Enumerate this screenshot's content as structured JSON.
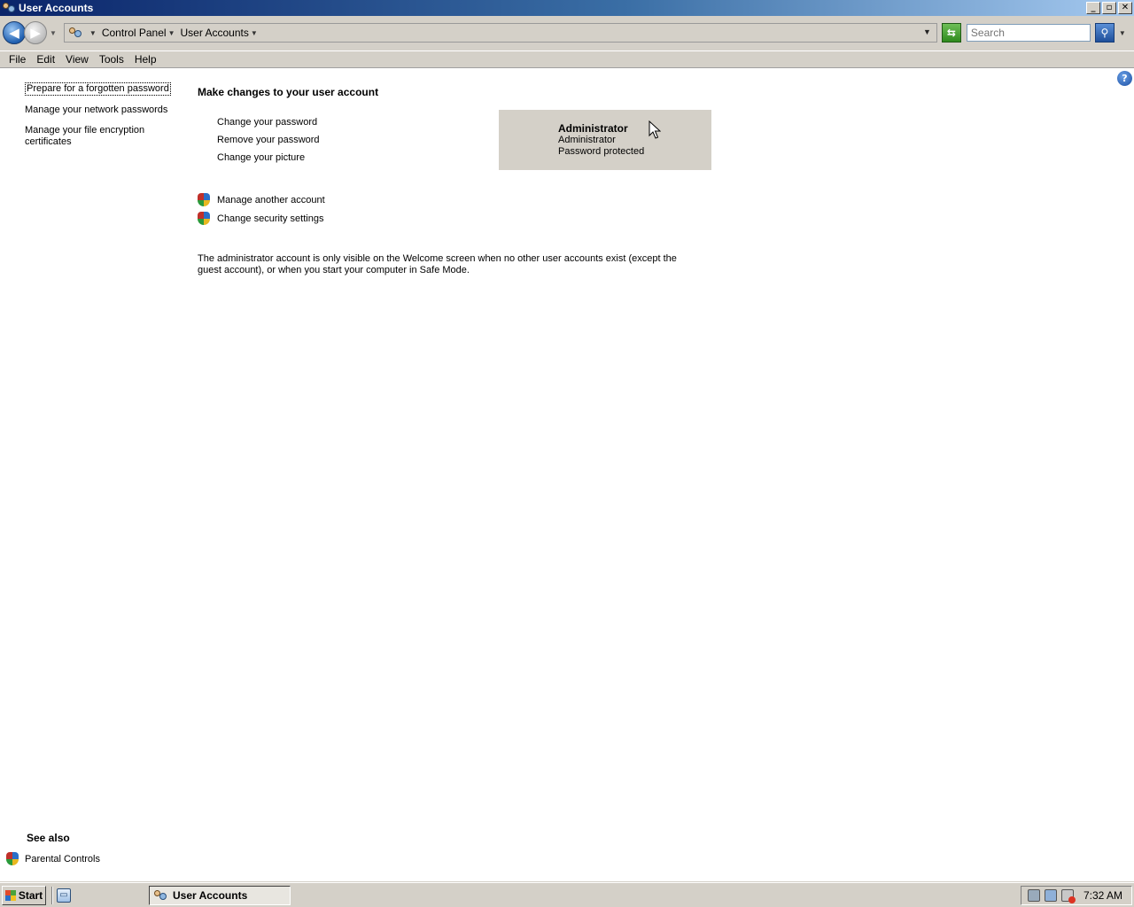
{
  "window": {
    "title": "User Accounts",
    "buttons": {
      "minimize": "_",
      "maximize": "▫",
      "close": "✕"
    }
  },
  "addressbar": {
    "breadcrumbs": [
      "Control Panel",
      "User Accounts"
    ],
    "search_placeholder": "Search"
  },
  "menu": [
    "File",
    "Edit",
    "View",
    "Tools",
    "Help"
  ],
  "help_label": "?",
  "tasks": [
    "Prepare for a forgotten password",
    "Manage your network passwords",
    "Manage your file encryption certificates"
  ],
  "main": {
    "heading": "Make changes to your user account",
    "actions": [
      "Change your password",
      "Remove your password",
      "Change your picture"
    ],
    "account": {
      "name": "Administrator",
      "role": "Administrator",
      "status": "Password protected"
    },
    "admin_links": [
      "Manage another account",
      "Change security settings"
    ],
    "note": "The administrator account is only visible on the Welcome screen when no other user accounts exist (except the guest account), or when you start your computer in Safe Mode."
  },
  "see_also": {
    "heading": "See also",
    "items": [
      "Parental Controls"
    ]
  },
  "taskbar": {
    "start_label": "Start",
    "window_button": "User Accounts",
    "clock": "7:32 AM"
  },
  "colors": {
    "title_start": "#0a246a",
    "title_end": "#a6caf0",
    "chrome": "#d4d0c8",
    "content_bg": "#ffffff"
  }
}
